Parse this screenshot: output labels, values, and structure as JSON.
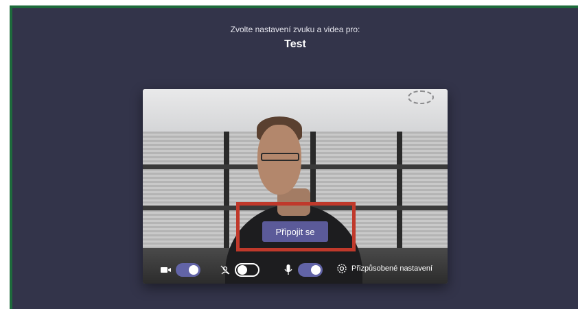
{
  "header": {
    "subtitle": "Zvolte nastavení zvuku a videa pro:",
    "meeting_title": "Test"
  },
  "preview": {
    "join_button_label": "Připojit se"
  },
  "controls": {
    "camera": {
      "icon": "camera-icon",
      "state": "on"
    },
    "background_blur": {
      "icon": "background-blur-icon",
      "state": "off"
    },
    "microphone": {
      "icon": "microphone-icon",
      "state": "on"
    },
    "settings": {
      "icon": "gear-icon",
      "label": "Přizpůsobené nastavení"
    }
  },
  "colors": {
    "background": "#33344a",
    "accent": "#6264a7",
    "button": "#5b5a99",
    "highlight": "#c0392b",
    "window_border": "#1e6b3c"
  }
}
